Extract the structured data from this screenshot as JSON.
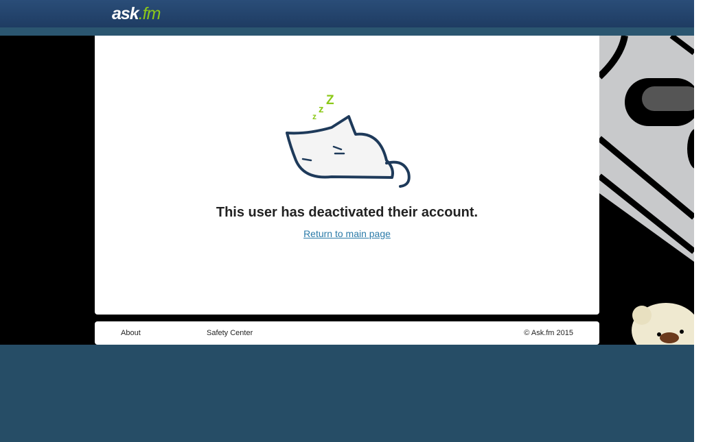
{
  "header": {
    "logo_text_main": "ask",
    "logo_text_accent": ".fm"
  },
  "main": {
    "message": "This user has deactivated their account.",
    "return_link": "Return to main page"
  },
  "footer": {
    "about": "About",
    "safety": "Safety Center",
    "copyright": "© Ask.fm 2015"
  },
  "colors": {
    "accent": "#8cc919",
    "link": "#2a7aa8",
    "background": "#264d66"
  }
}
